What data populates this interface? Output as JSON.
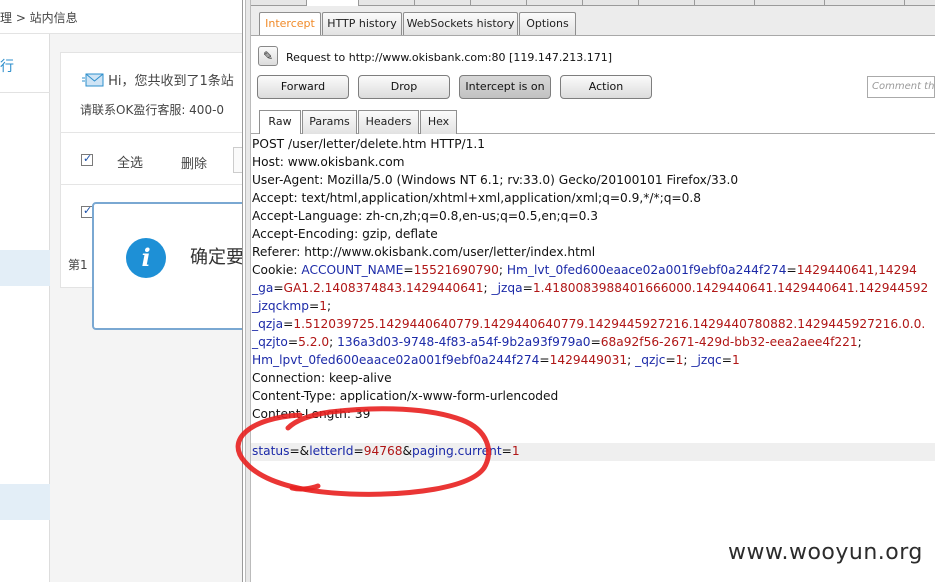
{
  "page": {
    "breadcrumb_tail": "理 > 站内信息",
    "nav_item_partial": "行",
    "notice_line1": "Hi，您共收到了1条站",
    "notice_line2": "请联系OK盈行客服: 400-0",
    "select_all": "全选",
    "delete": "删除",
    "pager_partial": "第1",
    "dialog_text": "确定要",
    "dialog_icon": "i"
  },
  "burp": {
    "tabs": [
      "Intercept",
      "HTTP history",
      "WebSockets history",
      "Options"
    ],
    "active_tab": "Intercept",
    "request_to": "Request to http://www.okisbank.com:80  [119.147.213.171]",
    "buttons": {
      "forward": "Forward",
      "drop": "Drop",
      "intercept": "Intercept is on",
      "action": "Action"
    },
    "comment_placeholder": "Comment this",
    "message_tabs": [
      "Raw",
      "Params",
      "Headers",
      "Hex"
    ],
    "active_message_tab": "Raw",
    "request_lines": {
      "l1": "POST /user/letter/delete.htm HTTP/1.1",
      "l2": "Host: www.okisbank.com",
      "l3": "User-Agent: Mozilla/5.0 (Windows NT 6.1; rv:33.0) Gecko/20100101 Firefox/33.0",
      "l4": "Accept: text/html,application/xhtml+xml,application/xml;q=0.9,*/*;q=0.8",
      "l5": "Accept-Language: zh-cn,zh;q=0.8,en-us;q=0.5,en;q=0.3",
      "l6": "Accept-Encoding: gzip, deflate",
      "l7": "Referer: http://www.okisbank.com/user/letter/index.html",
      "cookie_label": "Cookie: ",
      "c1k": "ACCOUNT_NAME",
      "c1v": "15521690790",
      "c2k": "Hm_lvt_0fed600eaace02a001f9ebf0a244f274",
      "c2v": "1429440641,14294",
      "c3k": "_ga",
      "c3v": "GA1.2.1408374843.1429440641",
      "c4k": "_jzqa",
      "c4v": "1.4180083988401666000.1429440641.1429440641.142944592",
      "c5k": "_jzqckmp",
      "c5v": "1",
      "c6k": "_qzja",
      "c6v": "1.512039725.1429440640779.1429440640779.1429445927216.1429440780882.1429445927216.0.0.",
      "c7k": "_qzjto",
      "c7v": "5.2.0",
      "c8k": "136a3d03-9748-4f83-a54f-9b2a93f979a0",
      "c8v": "68a92f56-2671-429d-bb32-eea2aee4f221",
      "c9k": "Hm_lpvt_0fed600eaace02a001f9ebf0a244f274",
      "c9v": "1429449031",
      "c10k": "_qzjc",
      "c10v": "1",
      "c11k": "_jzqc",
      "c11v": "1",
      "l9": "Connection: keep-alive",
      "l10": "Content-Type: application/x-www-form-urlencoded",
      "l11": "Content-Length: 39",
      "p1k": "status",
      "p1v": "",
      "p2k": "letterId",
      "p2v": "94768",
      "p3k": "paging.current",
      "p3v": "1"
    }
  },
  "watermark": "www.wooyun.org",
  "colors": {
    "intercept_tab": "#f08a28",
    "param_key": "#1c2aa8",
    "param_value": "#b01616",
    "annotation_circle": "#e8201f",
    "info_icon": "#1e90d6"
  }
}
